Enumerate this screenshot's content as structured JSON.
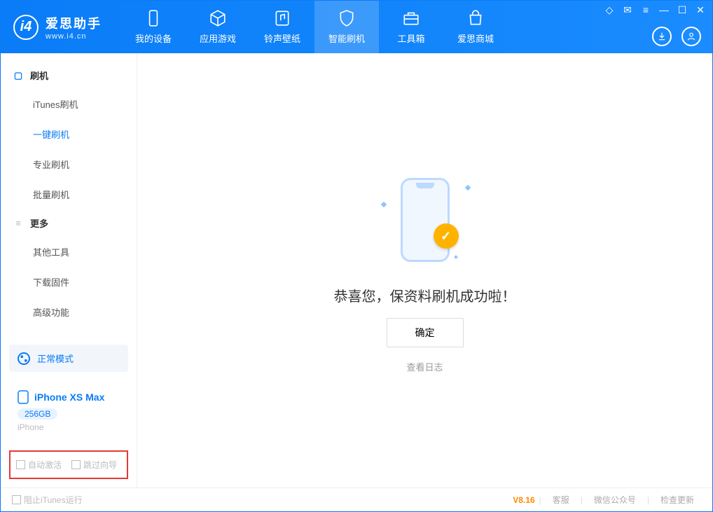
{
  "app": {
    "name": "爱思助手",
    "site": "www.i4.cn"
  },
  "nav": [
    {
      "label": "我的设备",
      "icon": "device"
    },
    {
      "label": "应用游戏",
      "icon": "cube"
    },
    {
      "label": "铃声壁纸",
      "icon": "music"
    },
    {
      "label": "智能刷机",
      "icon": "shield",
      "active": true
    },
    {
      "label": "工具箱",
      "icon": "toolbox"
    },
    {
      "label": "爱思商城",
      "icon": "bag"
    }
  ],
  "sidebar": {
    "sections": [
      {
        "title": "刷机",
        "icon": "phone",
        "items": [
          {
            "label": "iTunes刷机"
          },
          {
            "label": "一键刷机",
            "active": true
          },
          {
            "label": "专业刷机"
          },
          {
            "label": "批量刷机"
          }
        ]
      },
      {
        "title": "更多",
        "icon": "menu",
        "items": [
          {
            "label": "其他工具"
          },
          {
            "label": "下载固件"
          },
          {
            "label": "高级功能"
          }
        ]
      }
    ],
    "mode": "正常模式",
    "device": {
      "name": "iPhone XS Max",
      "capacity": "256GB",
      "type": "iPhone"
    },
    "options": {
      "auto_activate": "自动激活",
      "skip_guide": "跳过向导"
    }
  },
  "main": {
    "message": "恭喜您，保资料刷机成功啦！",
    "confirm": "确定",
    "view_log": "查看日志"
  },
  "status": {
    "block_itunes": "阻止iTunes运行",
    "version": "V8.16",
    "links": {
      "support": "客服",
      "wechat": "微信公众号",
      "update": "检查更新"
    }
  }
}
